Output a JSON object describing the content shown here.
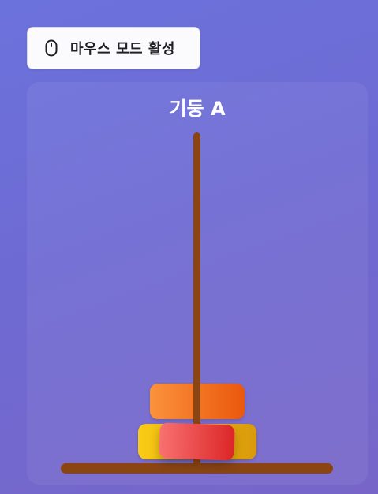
{
  "mouse_mode": {
    "label": "마우스 모드 활성",
    "icon": "mouse-icon"
  },
  "tower": {
    "title": "기둥 A",
    "pole_color": "#8b4513",
    "disks": [
      {
        "name": "orange",
        "colors": [
          "#fb923c",
          "#ea580c"
        ]
      },
      {
        "name": "yellow",
        "colors": [
          "#facc15",
          "#d99a0b"
        ]
      },
      {
        "name": "red",
        "colors": [
          "#f87171",
          "#dc2626"
        ],
        "state": "dragging"
      }
    ]
  }
}
